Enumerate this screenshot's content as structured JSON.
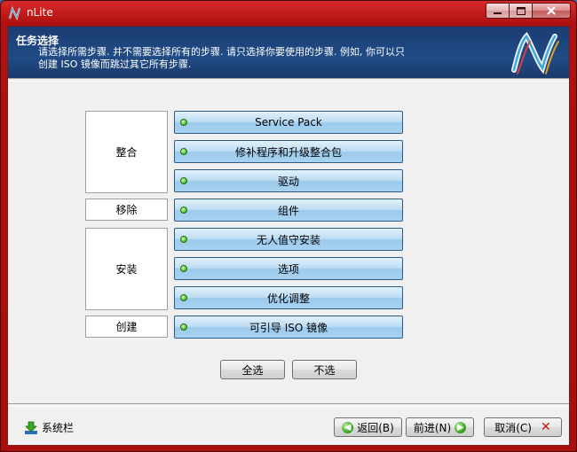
{
  "window": {
    "title": "nLite"
  },
  "header": {
    "title": "任务选择",
    "desc_line1": "请选择所需步骤. 并不需要选择所有的步骤. 请只选择你要使用的步骤. 例如, 你可以只",
    "desc_line2": "创建 ISO 镜像而跳过其它所有步骤."
  },
  "groups": {
    "integrate": "整合",
    "remove": "移除",
    "setup": "安装",
    "create": "创建"
  },
  "tasks": {
    "service_pack": "Service Pack",
    "hotfixes": "修补程序和升级整合包",
    "drivers": "驱动",
    "components": "组件",
    "unattended": "无人值守安装",
    "options": "选项",
    "tweaks": "优化调整",
    "bootable_iso": "可引导 ISO 镜像"
  },
  "selection": {
    "select_all": "全选",
    "select_none": "不选"
  },
  "footer": {
    "tray": "系统栏",
    "back": "返回(B)",
    "next": "前进(N)",
    "cancel": "取消(C)"
  }
}
